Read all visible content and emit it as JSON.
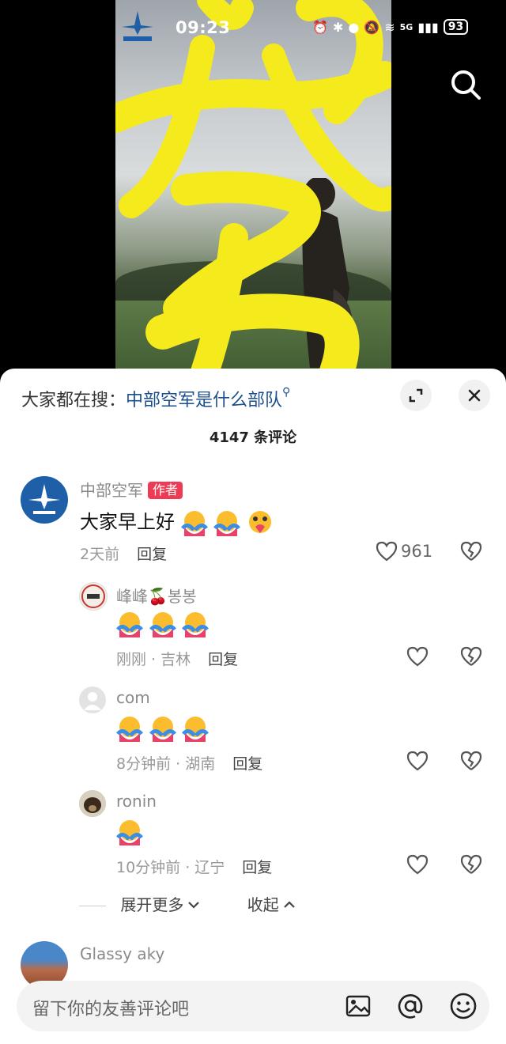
{
  "status_bar": {
    "time": "09:23",
    "battery": "93",
    "network": "5G"
  },
  "video": {
    "overlay_char": "梦"
  },
  "sheet": {
    "hot_search_prefix": "大家都在搜：",
    "hot_search_link": "中部空军是什么部队",
    "comment_count": "4147 条评论"
  },
  "comments": [
    {
      "author": "中部空军",
      "badge": "作者",
      "text": "大家早上好",
      "time": "2天前",
      "reply": "回复",
      "likes": "961",
      "replies": [
        {
          "author": "峰峰🍒봉봉",
          "text": "",
          "time": "刚刚 · 吉林",
          "reply": "回复"
        },
        {
          "author": "com",
          "text": "",
          "time": "8分钟前 · 湖南",
          "reply": "回复"
        },
        {
          "author": "ronin",
          "text": "",
          "time": "10分钟前 · 辽宁",
          "reply": "回复"
        }
      ],
      "expand_more": "展开更多",
      "collapse": "收起"
    },
    {
      "author": "Glassy aky"
    }
  ],
  "input": {
    "placeholder": "留下你的友善评论吧"
  },
  "icons": [
    "search-icon",
    "expand-icon",
    "close-icon",
    "heart-icon",
    "broken-heart-icon",
    "image-icon",
    "at-icon",
    "smile-icon"
  ]
}
